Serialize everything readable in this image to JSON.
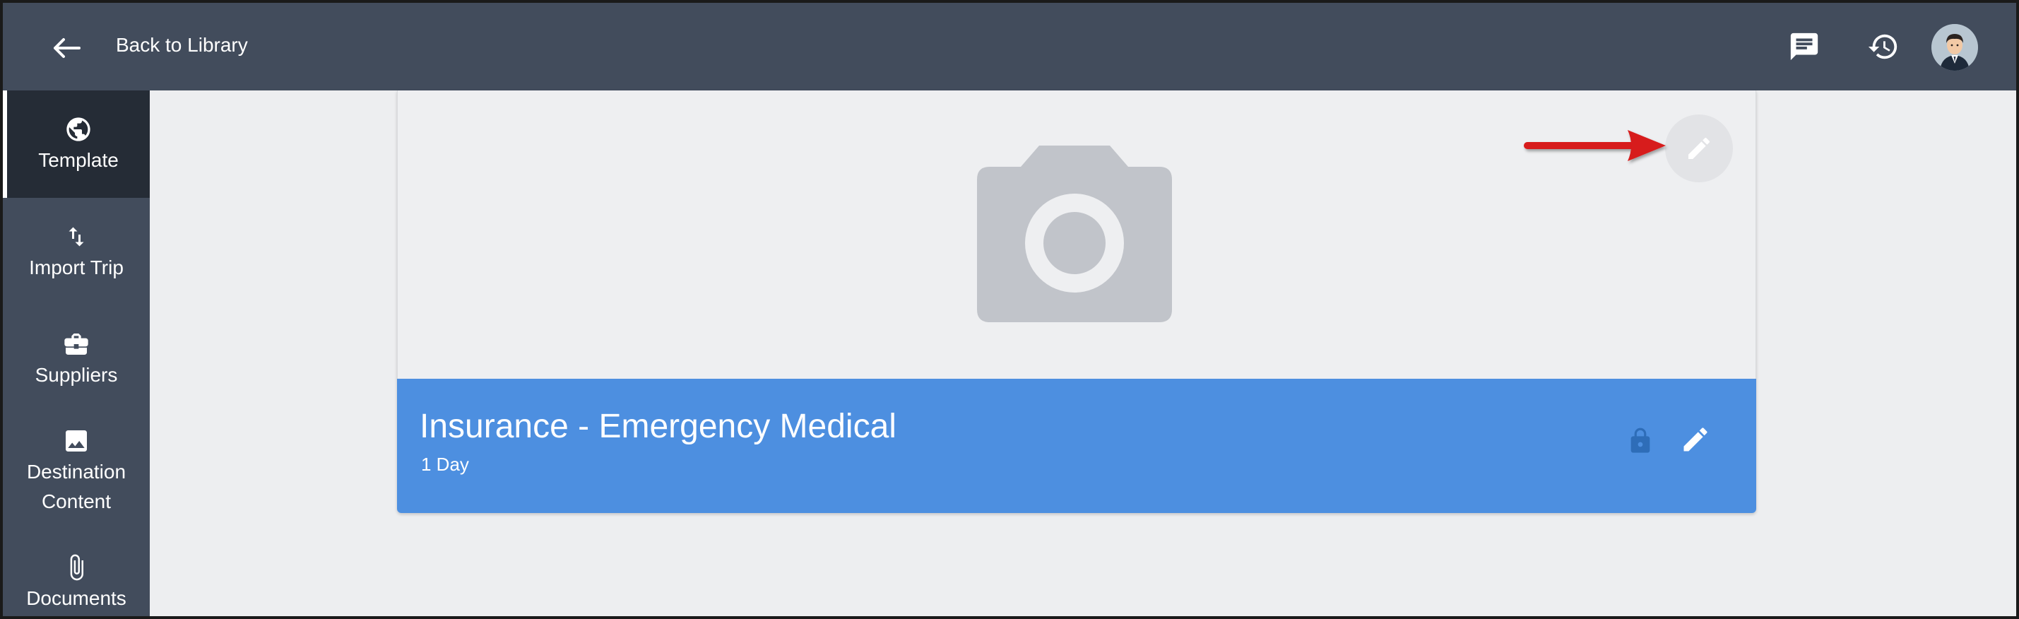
{
  "topbar": {
    "back_label": "Back to Library",
    "icons": [
      "arrow-left-icon",
      "chat-icon",
      "history-icon",
      "avatar"
    ]
  },
  "sidebar": {
    "items": [
      {
        "label": "Template",
        "icon": "globe-icon",
        "active": true
      },
      {
        "label": "Import Trip",
        "icon": "swap-vertical-icon",
        "active": false
      },
      {
        "label": "Suppliers",
        "icon": "briefcase-icon",
        "active": false
      },
      {
        "label": "Destination Content",
        "icon": "image-icon",
        "active": false
      },
      {
        "label": "Documents",
        "icon": "paperclip-icon",
        "active": false
      }
    ]
  },
  "card": {
    "title": "Insurance - Emergency Medical",
    "subtitle": "1 Day",
    "image_placeholder_icon": "camera-icon",
    "actions": [
      "lock-icon",
      "pencil-icon"
    ]
  },
  "colors": {
    "topbar": "#424c5c",
    "sidebar_active": "#252c36",
    "banner": "#4d8fe0",
    "background": "#edeef0",
    "annotation": "#d71a1a"
  }
}
